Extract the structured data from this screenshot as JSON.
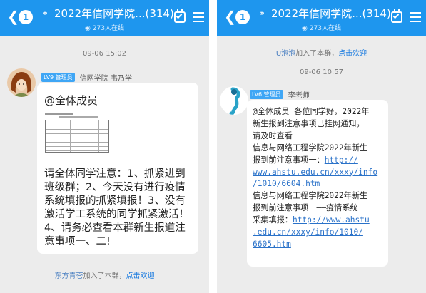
{
  "left": {
    "header": {
      "back": "<",
      "badge": "1",
      "title": "2022年信网学院...(314)",
      "online": "273人在线"
    },
    "timestamp": "09-06 15:02",
    "message": {
      "level": "LV9 管理员",
      "sender": "信网学院 韦乃学",
      "at_all": "@全体成员",
      "text": "请全体同学注意：1、抓紧进到班级群；2、今天没有进行疫情系统填报的抓紧填报！3、没有激活学工系统的同学抓紧激活！4、请务必查看本群新生报道注意事项一、二!"
    },
    "system_join": {
      "name": "东方青苍",
      "action": "加入了本群，",
      "welcome": "点击欢迎"
    }
  },
  "right": {
    "header": {
      "back": "<",
      "badge": "1",
      "title": "2022年信网学院...(314)",
      "online": "273人在线"
    },
    "system_join": {
      "name": "U泡泡",
      "action": "加入了本群，",
      "welcome": "点击欢迎"
    },
    "timestamp": "09-06 10:57",
    "message": {
      "level": "LV6 管理员",
      "sender": "李老师",
      "lines": [
        {
          "text": "@全体成员 各位同学好，2022年",
          "link": false
        },
        {
          "text": "新生报到注意事项已挂网通知，",
          "link": false
        },
        {
          "text": "请及时查看",
          "link": false
        },
        {
          "text": "信息与网络工程学院2022年新生",
          "link": false
        },
        {
          "text": "报到前注意事项一：",
          "link": false,
          "tail": "http://"
        },
        {
          "text": "www.ahstu.edu.cn/xxxy/info",
          "link": true
        },
        {
          "text": "/1010/6604.htm",
          "link": true
        },
        {
          "text": "信息与网络工程学院2022年新生",
          "link": false
        },
        {
          "text": "报到前注意事项二——疫情系统",
          "link": false
        },
        {
          "text": "采集填报：",
          "link": false,
          "tail": "http://www.ahstu"
        },
        {
          "text": ".edu.cn/xxxy/info/1010/",
          "link": true
        },
        {
          "text": "6605.htm",
          "link": true
        }
      ]
    }
  },
  "colors": {
    "topbar": "#1e96ee",
    "level_badge": "#3fa6f5",
    "link": "#2a72c9"
  },
  "icons": [
    "back-chevron-icon",
    "fire-icon",
    "checklist-icon",
    "menu-icon",
    "avatar-girl",
    "avatar-teacher"
  ]
}
